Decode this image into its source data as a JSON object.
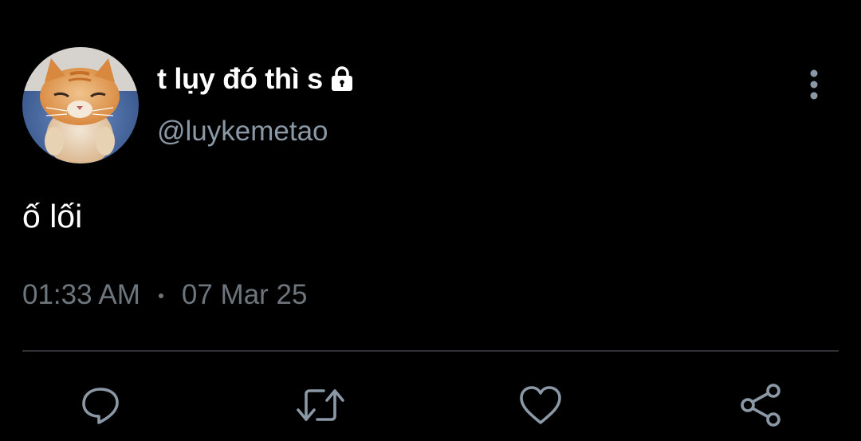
{
  "user": {
    "display_name": "t lụy đó thì s",
    "handle": "@luykemetao",
    "protected_icon": "lock-icon",
    "avatar_alt": "orange-cat-avatar"
  },
  "tweet": {
    "text": "ố lối",
    "time": "01:33 AM",
    "date": "07 Mar 25"
  },
  "actions": {
    "reply_icon": "reply-icon",
    "retweet_icon": "retweet-icon",
    "like_icon": "heart-icon",
    "share_icon": "share-icon",
    "more_icon": "more-vertical-icon"
  },
  "colors": {
    "background": "#000000",
    "primary_text": "#ffffff",
    "secondary_text": "#8b98a5",
    "meta_text": "#6e767d",
    "divider": "#2f3336",
    "icon": "#8b98a5",
    "avatar_bg": "#3d5f9a"
  }
}
